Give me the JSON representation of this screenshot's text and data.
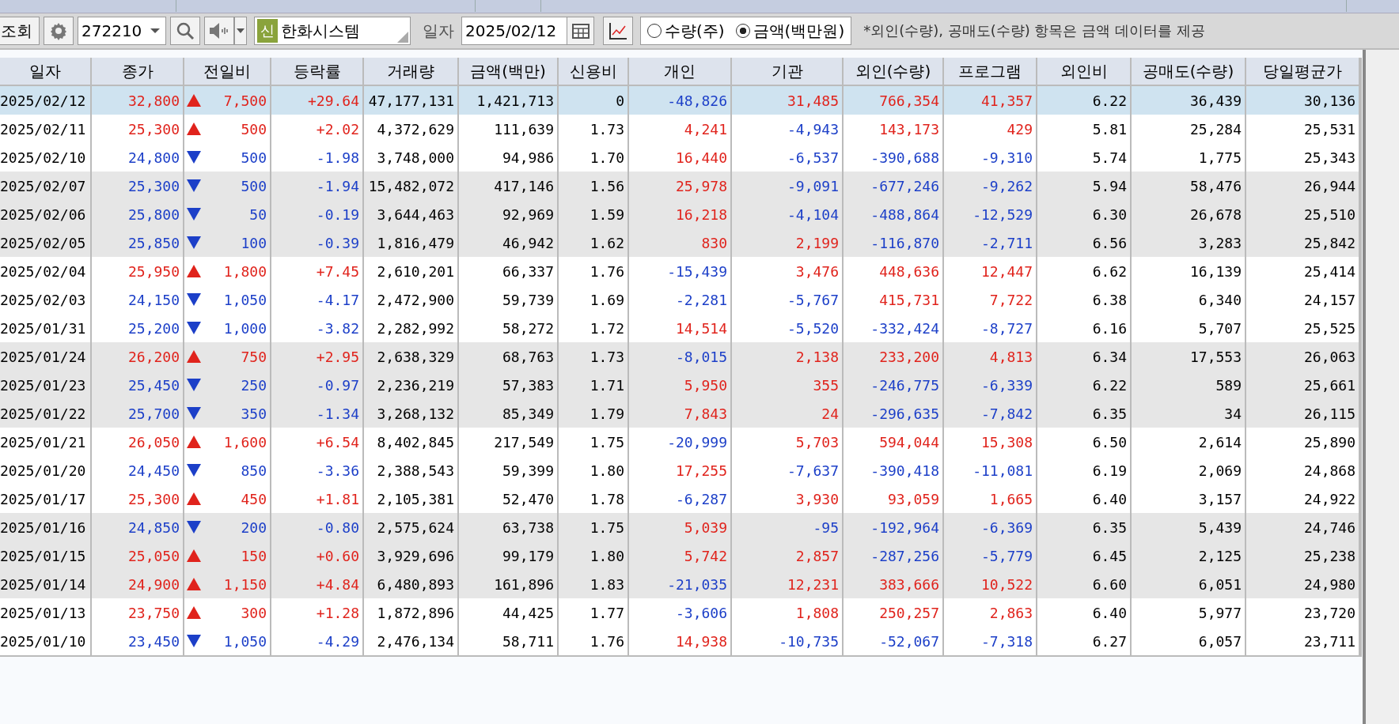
{
  "toolbar": {
    "query_button": "조회",
    "stock_code": "272210",
    "stock_badge": "신",
    "stock_name": "한화시스템",
    "date_label": "일자",
    "date": "2025/02/12",
    "units": [
      {
        "label": "수량(주)",
        "selected": false
      },
      {
        "label": "금액(백만원)",
        "selected": true
      }
    ],
    "notice": "*외인(수량), 공매도(수량) 항목은 금액 데이터를 제공"
  },
  "table": {
    "columns": [
      "일자",
      "종가",
      "전일비",
      "등락률",
      "거래량",
      "금액(백만)",
      "신용비",
      "개인",
      "기관",
      "외인(수량)",
      "프로그램",
      "외인비",
      "공매도(수량)",
      "당일평균가"
    ],
    "rows": [
      {
        "rising": true,
        "selected": true,
        "shaded": false,
        "cells": [
          "2025/02/12",
          "32,800",
          "7,500",
          "+29.64",
          "47,177,131",
          "1,421,713",
          "0",
          "-48,826",
          "31,485",
          "766,354",
          "41,357",
          "6.22",
          "36,439",
          "30,136"
        ]
      },
      {
        "rising": true,
        "selected": false,
        "shaded": false,
        "cells": [
          "2025/02/11",
          "25,300",
          "500",
          "+2.02",
          "4,372,629",
          "111,639",
          "1.73",
          "4,241",
          "-4,943",
          "143,173",
          "429",
          "5.81",
          "25,284",
          "25,531"
        ]
      },
      {
        "rising": false,
        "selected": false,
        "shaded": false,
        "cells": [
          "2025/02/10",
          "24,800",
          "500",
          "-1.98",
          "3,748,000",
          "94,986",
          "1.70",
          "16,440",
          "-6,537",
          "-390,688",
          "-9,310",
          "5.74",
          "1,775",
          "25,343"
        ]
      },
      {
        "rising": false,
        "selected": false,
        "shaded": true,
        "cells": [
          "2025/02/07",
          "25,300",
          "500",
          "-1.94",
          "15,482,072",
          "417,146",
          "1.56",
          "25,978",
          "-9,091",
          "-677,246",
          "-9,262",
          "5.94",
          "58,476",
          "26,944"
        ]
      },
      {
        "rising": false,
        "selected": false,
        "shaded": true,
        "cells": [
          "2025/02/06",
          "25,800",
          "50",
          "-0.19",
          "3,644,463",
          "92,969",
          "1.59",
          "16,218",
          "-4,104",
          "-488,864",
          "-12,529",
          "6.30",
          "26,678",
          "25,510"
        ]
      },
      {
        "rising": false,
        "selected": false,
        "shaded": true,
        "cells": [
          "2025/02/05",
          "25,850",
          "100",
          "-0.39",
          "1,816,479",
          "46,942",
          "1.62",
          "830",
          "2,199",
          "-116,870",
          "-2,711",
          "6.56",
          "3,283",
          "25,842"
        ]
      },
      {
        "rising": true,
        "selected": false,
        "shaded": false,
        "cells": [
          "2025/02/04",
          "25,950",
          "1,800",
          "+7.45",
          "2,610,201",
          "66,337",
          "1.76",
          "-15,439",
          "3,476",
          "448,636",
          "12,447",
          "6.62",
          "16,139",
          "25,414"
        ]
      },
      {
        "rising": false,
        "selected": false,
        "shaded": false,
        "cells": [
          "2025/02/03",
          "24,150",
          "1,050",
          "-4.17",
          "2,472,900",
          "59,739",
          "1.69",
          "-2,281",
          "-5,767",
          "415,731",
          "7,722",
          "6.38",
          "6,340",
          "24,157"
        ]
      },
      {
        "rising": false,
        "selected": false,
        "shaded": false,
        "cells": [
          "2025/01/31",
          "25,200",
          "1,000",
          "-3.82",
          "2,282,992",
          "58,272",
          "1.72",
          "14,514",
          "-5,520",
          "-332,424",
          "-8,727",
          "6.16",
          "5,707",
          "25,525"
        ]
      },
      {
        "rising": true,
        "selected": false,
        "shaded": true,
        "cells": [
          "2025/01/24",
          "26,200",
          "750",
          "+2.95",
          "2,638,329",
          "68,763",
          "1.73",
          "-8,015",
          "2,138",
          "233,200",
          "4,813",
          "6.34",
          "17,553",
          "26,063"
        ]
      },
      {
        "rising": false,
        "selected": false,
        "shaded": true,
        "cells": [
          "2025/01/23",
          "25,450",
          "250",
          "-0.97",
          "2,236,219",
          "57,383",
          "1.71",
          "5,950",
          "355",
          "-246,775",
          "-6,339",
          "6.22",
          "589",
          "25,661"
        ]
      },
      {
        "rising": false,
        "selected": false,
        "shaded": true,
        "cells": [
          "2025/01/22",
          "25,700",
          "350",
          "-1.34",
          "3,268,132",
          "85,349",
          "1.79",
          "7,843",
          "24",
          "-296,635",
          "-7,842",
          "6.35",
          "34",
          "26,115"
        ]
      },
      {
        "rising": true,
        "selected": false,
        "shaded": false,
        "cells": [
          "2025/01/21",
          "26,050",
          "1,600",
          "+6.54",
          "8,402,845",
          "217,549",
          "1.75",
          "-20,999",
          "5,703",
          "594,044",
          "15,308",
          "6.50",
          "2,614",
          "25,890"
        ]
      },
      {
        "rising": false,
        "selected": false,
        "shaded": false,
        "cells": [
          "2025/01/20",
          "24,450",
          "850",
          "-3.36",
          "2,388,543",
          "59,399",
          "1.80",
          "17,255",
          "-7,637",
          "-390,418",
          "-11,081",
          "6.19",
          "2,069",
          "24,868"
        ]
      },
      {
        "rising": true,
        "selected": false,
        "shaded": false,
        "cells": [
          "2025/01/17",
          "25,300",
          "450",
          "+1.81",
          "2,105,381",
          "52,470",
          "1.78",
          "-6,287",
          "3,930",
          "93,059",
          "1,665",
          "6.40",
          "3,157",
          "24,922"
        ]
      },
      {
        "rising": false,
        "selected": false,
        "shaded": true,
        "cells": [
          "2025/01/16",
          "24,850",
          "200",
          "-0.80",
          "2,575,624",
          "63,738",
          "1.75",
          "5,039",
          "-95",
          "-192,964",
          "-6,369",
          "6.35",
          "5,439",
          "24,746"
        ]
      },
      {
        "rising": true,
        "selected": false,
        "shaded": true,
        "cells": [
          "2025/01/15",
          "25,050",
          "150",
          "+0.60",
          "3,929,696",
          "99,179",
          "1.80",
          "5,742",
          "2,857",
          "-287,256",
          "-5,779",
          "6.45",
          "2,125",
          "25,238"
        ]
      },
      {
        "rising": true,
        "selected": false,
        "shaded": true,
        "cells": [
          "2025/01/14",
          "24,900",
          "1,150",
          "+4.84",
          "6,480,893",
          "161,896",
          "1.83",
          "-21,035",
          "12,231",
          "383,666",
          "10,522",
          "6.60",
          "6,051",
          "24,980"
        ]
      },
      {
        "rising": true,
        "selected": false,
        "shaded": false,
        "cells": [
          "2025/01/13",
          "23,750",
          "300",
          "+1.28",
          "1,872,896",
          "44,425",
          "1.77",
          "-3,606",
          "1,808",
          "250,257",
          "2,863",
          "6.40",
          "5,977",
          "23,720"
        ]
      },
      {
        "rising": false,
        "selected": false,
        "shaded": false,
        "cells": [
          "2025/01/10",
          "23,450",
          "1,050",
          "-4.29",
          "2,476,134",
          "58,711",
          "1.76",
          "14,938",
          "-10,735",
          "-52,067",
          "-7,318",
          "6.27",
          "6,057",
          "23,711"
        ]
      }
    ]
  }
}
